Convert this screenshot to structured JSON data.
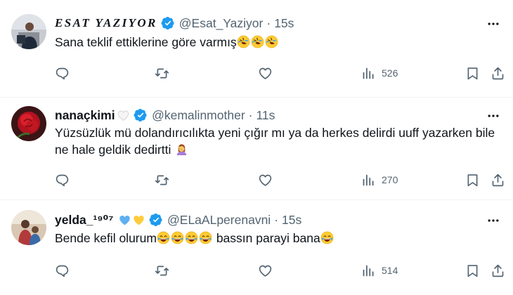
{
  "tweets": [
    {
      "display_name": "ESAT YAZIYOR",
      "handle": "@Esat_Yaziyor",
      "separator": "·",
      "time": "15s",
      "text": "Sana teklif ettiklerine göre varmış",
      "trailing_emojis": [
        "rofl-emoji",
        "rofl-emoji",
        "rofl-emoji"
      ],
      "views": "526",
      "verified": true
    },
    {
      "display_name": "nanaçkimi",
      "name_emoji": "white-heart-emoji",
      "handle": "@kemalinmother",
      "separator": "·",
      "time": "11s",
      "text": "Yüzsüzlük mü dolandırıcılıkta yeni çığır mı ya da herkes delirdi uuff yazarken bile ne hale geldik dedirtti",
      "trailing_emojis": [
        "facepalm-emoji"
      ],
      "views": "270",
      "verified": true
    },
    {
      "display_name": "yelda_¹⁹⁰⁷",
      "name_emoji": [
        "blue-heart-emoji",
        "yellow-heart-emoji"
      ],
      "handle": "@ELaALperenavni",
      "separator": "·",
      "time": "15s",
      "text_before": "Bende kefil olurum",
      "middle_emojis": [
        "joy-emoji",
        "joy-emoji",
        "joy-emoji",
        "joy-emoji"
      ],
      "text_after": " bassın parayi bana",
      "trailing_emojis": [
        "joy-emoji"
      ],
      "views": "514",
      "verified": true
    }
  ],
  "icons": [
    "verified-badge-icon",
    "more-icon",
    "reply-icon",
    "retweet-icon",
    "like-icon",
    "views-icon",
    "bookmark-icon",
    "share-icon"
  ],
  "colors": {
    "verified": "#1d9bf0",
    "text": "#0f1419",
    "secondary": "#536471",
    "divider": "#eff3f4"
  }
}
